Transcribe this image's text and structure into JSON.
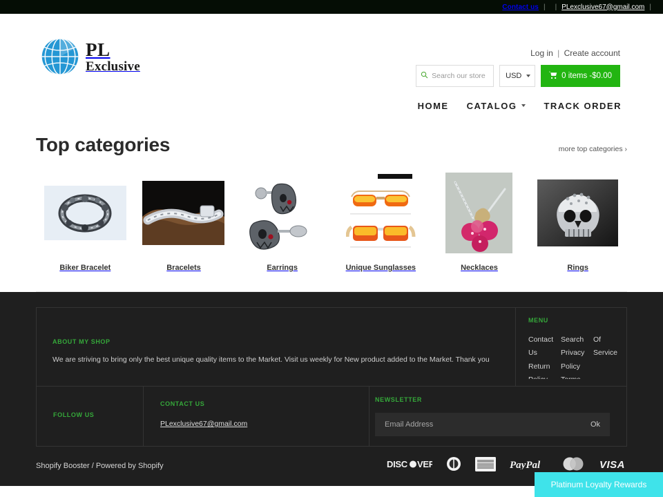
{
  "topbar": {
    "contact_us": "Contact us",
    "separator": "|",
    "email": "PLexclusive67@gmail.com"
  },
  "header": {
    "logo_primary": "PL",
    "logo_secondary": "Exclusive",
    "logo_icon": "globe-icon",
    "login_label": "Log in",
    "divider": "|",
    "create_account_label": "Create account",
    "search_placeholder": "Search our store",
    "search_value": "",
    "currency": "USD",
    "cart_label": "0 items -$0.00",
    "cart_icon": "shopping-cart-icon"
  },
  "nav": {
    "items": [
      {
        "label": "HOME",
        "has_caret": false
      },
      {
        "label": "CATALOG",
        "has_caret": true
      },
      {
        "label": "TRACK ORDER",
        "has_caret": false
      }
    ]
  },
  "main": {
    "section_title": "Top categories",
    "more_link": "more top categories ›",
    "categories": [
      {
        "label": "Biker Bracelet",
        "image": "silver-skull-bead-bracelet-on-light-blue-background"
      },
      {
        "label": "Bracelets",
        "image": "silver-cuban-link-bracelet-on-driftwood-dark-background"
      },
      {
        "label": "Earrings",
        "image": "pair-of-silver-skull-stud-earrings-white-background"
      },
      {
        "label": "Unique Sunglasses",
        "image": "two-pairs-orange-mirrored-sunglasses-white-background"
      },
      {
        "label": "Necklaces",
        "image": "pink-crystal-flower-pendant-necklace-grey-background"
      },
      {
        "label": "Rings",
        "image": "silver-skull-ring-dark-gradient-background"
      }
    ]
  },
  "footer": {
    "about_heading": "ABOUT MY SHOP",
    "about_text": "We are striving to bring only the best unique quality items to the Market. Visit us weekly for New product added to the Market. Thank you",
    "menu_heading": "MENU",
    "menu_columns": [
      [
        "Contact Us",
        "Return Policy"
      ],
      [
        "Search",
        "Privacy Policy",
        "Terms of Service"
      ],
      [
        "Of Service"
      ]
    ],
    "menu_col1": [
      "Contact",
      "Us",
      "Return",
      "Policy"
    ],
    "menu_col2": [
      "Search",
      "Privacy",
      "Policy",
      "Terms"
    ],
    "menu_col3": [
      "Of",
      "Service"
    ],
    "follow_heading": "FOLLOW US",
    "contact_heading": "CONTACT US",
    "contact_email": "PLexclusive67@gmail.com",
    "newsletter_heading": "NEWSLETTER",
    "newsletter_placeholder": "Email Address",
    "newsletter_value": "",
    "newsletter_button": "Ok",
    "credit": "Shopify Booster / Powered by Shopify",
    "payment_icons": [
      "discover-icon",
      "diners-club-icon",
      "american-express-icon",
      "paypal-icon",
      "mastercard-icon",
      "visa-icon"
    ],
    "payment_labels": {
      "discover": "DISC●VER",
      "amex": "AMERICAN EXPRESS",
      "paypal": "PayPal",
      "visa": "VISA"
    }
  },
  "widget": {
    "loyalty_label": "Platinum Loyalty Rewards"
  },
  "colors": {
    "topbar_bg": "#050d05",
    "cart_green": "#22b511",
    "footer_bg": "#1f1f1f",
    "heading_green": "#35a83a",
    "loyalty_cyan": "#3fe3ea",
    "logo_blue": "#2497d4"
  }
}
